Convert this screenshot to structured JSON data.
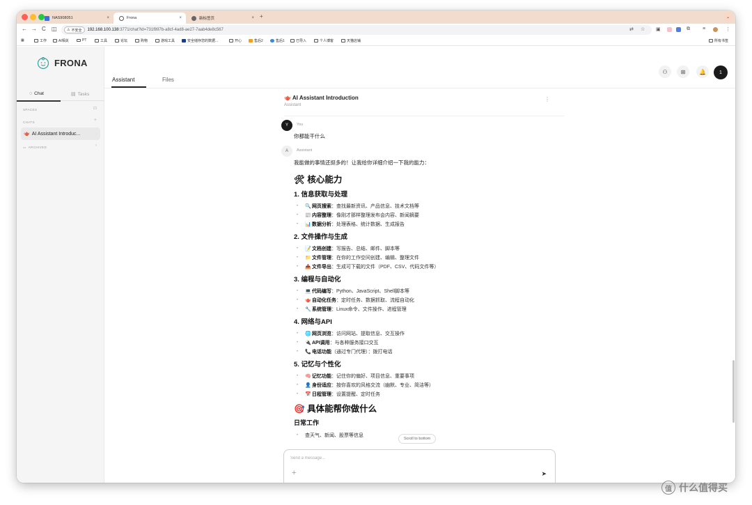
{
  "browser": {
    "traffic_lights": [
      "#ff5f57",
      "#febc2e",
      "#28c840"
    ],
    "tabs": [
      {
        "title": "NAS908051",
        "close": "×"
      },
      {
        "title": "Frona",
        "close": "×"
      },
      {
        "title": "新标签页",
        "close": "×"
      }
    ],
    "new_tab": "+",
    "tab_menu": "⌄",
    "nav": {
      "back": "←",
      "forward": "→",
      "reload": "C",
      "sidepanel": "◫"
    },
    "security_label": "不安全",
    "url_host": "192.168.100.138",
    "url_path": ":3771/chat?id=731f897b-a8cf-4ad8-ae27-7aab4de8c567",
    "bookmarks": [
      "工作",
      "AI相关",
      "PT",
      "工具",
      "论坛",
      "购物",
      "游戏工具",
      "安全储存您的数据...",
      "开心",
      "售后2",
      "售后1",
      "已导入",
      "个人博客",
      "天猫店铺"
    ],
    "all_bookmarks": "所有书签"
  },
  "app": {
    "logo_text": "FRONA",
    "sidebar": {
      "tabs": [
        {
          "label": "Chat",
          "icon": "chat-icon"
        },
        {
          "label": "Tasks",
          "icon": "tasks-icon"
        }
      ],
      "spaces_label": "SPACES",
      "chats_label": "CHATS",
      "archived_label": "ARCHIVED",
      "chat_items": [
        {
          "label": "AI Assistant Introduc..."
        }
      ]
    },
    "header": {
      "tabs": [
        "Assistant",
        "Files"
      ],
      "avatar_initial": "1"
    },
    "conversation": {
      "title": "AI Assistant Introduction",
      "subtitle": "Assistant",
      "title_emoji": "🫖",
      "user": {
        "initial": "Y",
        "name": "You",
        "message": "你都能干什么"
      },
      "assistant": {
        "initial": "A",
        "name": "Assistant",
        "intro": "我能做的事情还挺多的！让我给你详细介绍一下我的能力：",
        "h_core": {
          "emoji": "🛠",
          "text": "核心能力"
        },
        "sections": [
          {
            "title": "1. 信息获取与处理",
            "items": [
              {
                "emoji": "🔍",
                "bold": "网页搜索",
                "text": "：查找最新资讯、产品信息、技术文档等"
              },
              {
                "emoji": "📰",
                "bold": "内容整理",
                "text": "：像刚才那样整理发布会内容、新闻摘要"
              },
              {
                "emoji": "📊",
                "bold": "数据分析",
                "text": "：处理表格、统计数据、生成报告"
              }
            ]
          },
          {
            "title": "2. 文件操作与生成",
            "items": [
              {
                "emoji": "📝",
                "bold": "文档创建",
                "text": "：写报告、总结、邮件、脚本等"
              },
              {
                "emoji": "📁",
                "bold": "文件管理",
                "text": "：在你的工作空间创建、编辑、整理文件"
              },
              {
                "emoji": "📤",
                "bold": "文件导出",
                "text": "：生成可下载的文件（PDF、CSV、代码文件等）"
              }
            ]
          },
          {
            "title": "3. 编程与自动化",
            "items": [
              {
                "emoji": "💻",
                "bold": "代码编写",
                "text": "：Python、JavaScript、Shell脚本等"
              },
              {
                "emoji": "🫖",
                "bold": "自动化任务",
                "text": "：定时任务、数据抓取、流程自动化"
              },
              {
                "emoji": "🔧",
                "bold": "系统管理",
                "text": "：Linux命令、文件操作、进程管理"
              }
            ]
          },
          {
            "title": "4. 网络与API",
            "items": [
              {
                "emoji": "🌐",
                "bold": "网页浏览",
                "text": "：访问网站、提取信息、交互操作"
              },
              {
                "emoji": "🔌",
                "bold": "API调用",
                "text": "：与各种服务接口交互"
              },
              {
                "emoji": "📞",
                "bold": "电话功能",
                "text": "（通过专门代理）：拨打电话"
              }
            ]
          },
          {
            "title": "5. 记忆与个性化",
            "items": [
              {
                "emoji": "🧠",
                "bold": "记忆功能",
                "text": "：记住你的偏好、项目信息、重要事项"
              },
              {
                "emoji": "👤",
                "bold": "身份适应",
                "text": "：按你喜欢的风格交流（幽默、专业、简洁等）"
              },
              {
                "emoji": "📅",
                "bold": "日程管理",
                "text": "：设置提醒、定时任务"
              }
            ]
          }
        ],
        "h_help": {
          "emoji": "🎯",
          "text": "具体能帮你做什么"
        },
        "daily": {
          "title": "日常工作",
          "items": [
            {
              "text": "查天气、新闻、股票等信息"
            }
          ]
        }
      }
    },
    "scroll_to_bottom": "Scroll to bottom",
    "composer": {
      "placeholder": "Send a message...",
      "plus": "+",
      "send": "➤"
    }
  },
  "watermark": {
    "icon": "值",
    "text": "什么值得买"
  }
}
